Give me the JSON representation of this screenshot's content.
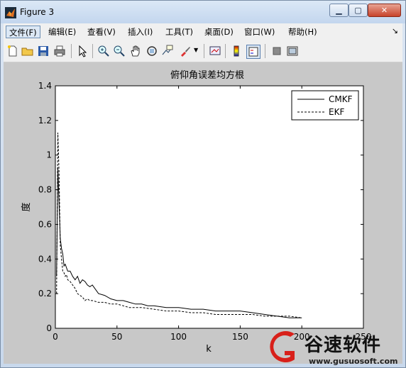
{
  "window": {
    "title": "Figure 3"
  },
  "menu": [
    {
      "label": "文件(F)"
    },
    {
      "label": "编辑(E)"
    },
    {
      "label": "查看(V)"
    },
    {
      "label": "插入(I)"
    },
    {
      "label": "工具(T)"
    },
    {
      "label": "桌面(D)"
    },
    {
      "label": "窗口(W)"
    },
    {
      "label": "帮助(H)"
    }
  ],
  "toolbar_icons": [
    "new-figure-icon",
    "open-file-icon",
    "save-icon",
    "print-icon",
    "edit-plot-icon",
    "zoom-in-icon",
    "zoom-out-icon",
    "pan-icon",
    "rotate-3d-icon",
    "data-cursor-icon",
    "brush-icon",
    "link-plot-icon",
    "insert-colorbar-icon",
    "insert-legend-icon",
    "hide-plot-tools-icon",
    "show-plot-tools-icon"
  ],
  "watermark": {
    "brand": "谷速软件",
    "url": "www.gusuosoft.com"
  },
  "chart_data": {
    "type": "line",
    "title": "俯仰角误差均方根",
    "xlabel": "k",
    "ylabel": "度",
    "xlim": [
      0,
      250
    ],
    "ylim": [
      0,
      1.4
    ],
    "xticks": [
      0,
      50,
      100,
      150,
      200,
      250
    ],
    "yticks": [
      0,
      0.2,
      0.4,
      0.6,
      0.8,
      1,
      1.2,
      1.4
    ],
    "legend_position": "top-right",
    "series": [
      {
        "name": "CMKF",
        "style": "solid",
        "x": [
          1,
          2,
          3,
          4,
          5,
          6,
          7,
          8,
          10,
          12,
          14,
          16,
          18,
          20,
          22,
          24,
          26,
          28,
          30,
          35,
          40,
          45,
          50,
          55,
          60,
          65,
          70,
          75,
          80,
          90,
          100,
          110,
          120,
          130,
          140,
          150,
          160,
          170,
          180,
          190,
          200
        ],
        "y": [
          0.3,
          0.93,
          0.72,
          0.52,
          0.46,
          0.43,
          0.36,
          0.37,
          0.33,
          0.33,
          0.3,
          0.28,
          0.3,
          0.26,
          0.28,
          0.27,
          0.25,
          0.24,
          0.25,
          0.2,
          0.19,
          0.17,
          0.16,
          0.16,
          0.15,
          0.14,
          0.14,
          0.13,
          0.13,
          0.12,
          0.12,
          0.11,
          0.11,
          0.1,
          0.1,
          0.1,
          0.09,
          0.08,
          0.07,
          0.06,
          0.06
        ]
      },
      {
        "name": "EKF",
        "style": "dashed",
        "x": [
          1,
          2,
          3,
          4,
          5,
          6,
          7,
          8,
          9,
          10,
          12,
          14,
          16,
          18,
          20,
          22,
          24,
          26,
          28,
          30,
          35,
          40,
          45,
          50,
          55,
          60,
          65,
          70,
          80,
          90,
          100,
          110,
          120,
          130,
          140,
          150,
          160,
          170,
          180,
          190,
          200
        ],
        "y": [
          0.2,
          1.13,
          0.9,
          0.48,
          0.4,
          0.33,
          0.32,
          0.3,
          0.31,
          0.28,
          0.27,
          0.25,
          0.23,
          0.2,
          0.19,
          0.18,
          0.16,
          0.17,
          0.16,
          0.16,
          0.15,
          0.15,
          0.14,
          0.14,
          0.13,
          0.12,
          0.12,
          0.12,
          0.11,
          0.1,
          0.1,
          0.09,
          0.09,
          0.08,
          0.08,
          0.08,
          0.08,
          0.07,
          0.07,
          0.07,
          0.06
        ]
      }
    ]
  }
}
